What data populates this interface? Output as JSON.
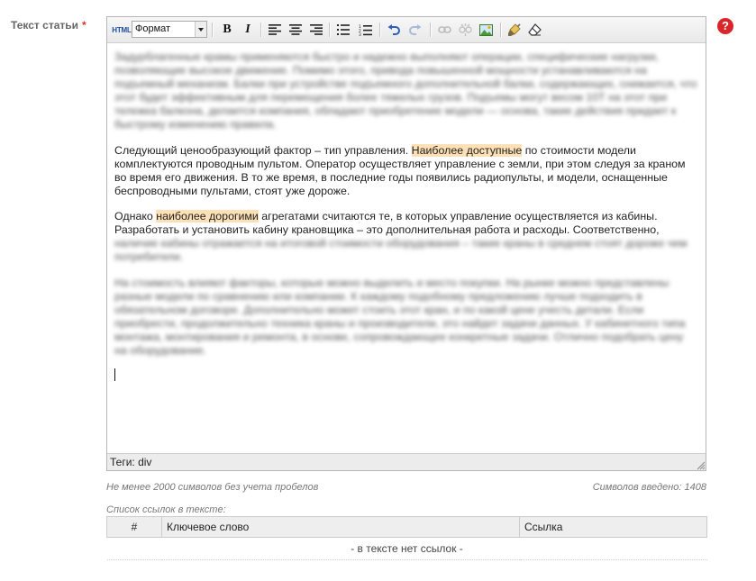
{
  "field": {
    "label": "Текст статьи",
    "required_mark": "*",
    "help_glyph": "?"
  },
  "toolbar": {
    "html_label": "HTML",
    "format_value": "Формат",
    "bold_label": "B",
    "italic_label": "I",
    "icons": [
      "align-left-icon",
      "align-center-icon",
      "align-right-icon",
      "bullet-list-icon",
      "numbered-list-icon",
      "undo-icon",
      "redo-icon",
      "link-icon",
      "unlink-icon",
      "insert-image-icon",
      "clean-brush-icon",
      "eraser-icon"
    ]
  },
  "content": {
    "para1_text": "Следующий ценообразующий фактор – тип управления. ",
    "para1_highlight": "Наиболее доступные",
    "para1_rest": " по стоимости модели комплектуются проводным пультом. Оператор осуществляет управление с земли, при этом следуя за краном во время его движения. В то же время, в последние годы появились радиопульты, и модели, оснащенные беспроводными пультами, стоят уже дороже.",
    "para2_start": "Однако ",
    "para2_highlight": "наиболее дорогими",
    "para2_rest": " агрегатами считаются те, в которых управление осуществляется из кабины. Разработать и установить кабину крановщика – это дополнительная работа и расходы. Соответственно,"
  },
  "statusbar": {
    "tags_label": "Теги: div"
  },
  "hints": {
    "min_chars": "Не менее 2000 символов без учета пробелов",
    "chars_entered": "Символов введено: 1408"
  },
  "links": {
    "label": "Список ссылок в тексте:",
    "col_num": "#",
    "col_keyword": "Ключевое слово",
    "col_link": "Ссылка",
    "empty_text": "- в тексте нет ссылок -"
  },
  "colors": {
    "highlight": "#fde0b5",
    "required": "#d33",
    "help": "#d8262a"
  }
}
